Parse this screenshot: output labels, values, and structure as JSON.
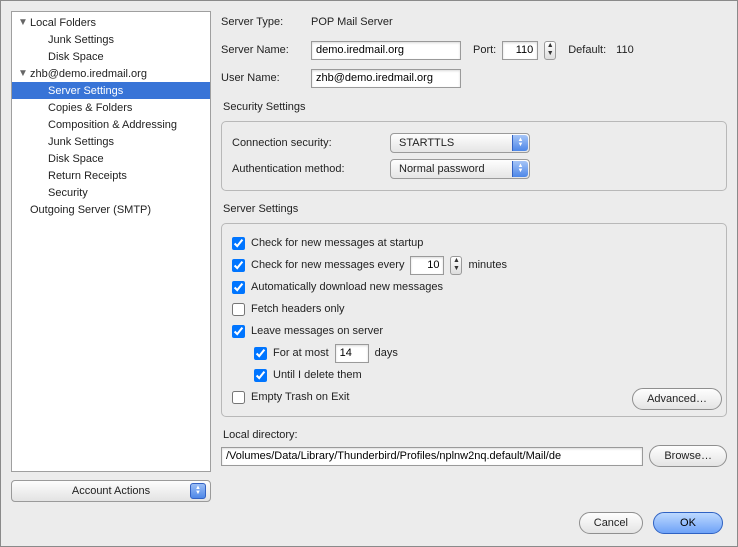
{
  "sidebar": {
    "items": [
      {
        "label": "Local Folders",
        "level": 0,
        "expandable": true
      },
      {
        "label": "Junk Settings",
        "level": 1
      },
      {
        "label": "Disk Space",
        "level": 1
      },
      {
        "label": "zhb@demo.iredmail.org",
        "level": 0,
        "expandable": true
      },
      {
        "label": "Server Settings",
        "level": 1,
        "selected": true
      },
      {
        "label": "Copies & Folders",
        "level": 1
      },
      {
        "label": "Composition & Addressing",
        "level": 1
      },
      {
        "label": "Junk Settings",
        "level": 1
      },
      {
        "label": "Disk Space",
        "level": 1
      },
      {
        "label": "Return Receipts",
        "level": 1
      },
      {
        "label": "Security",
        "level": 1
      },
      {
        "label": "Outgoing Server (SMTP)",
        "level": 0
      }
    ],
    "account_actions_label": "Account Actions"
  },
  "header": {
    "server_type_label": "Server Type:",
    "server_type_value": "POP Mail Server",
    "server_name_label": "Server Name:",
    "server_name_value": "demo.iredmail.org",
    "port_label": "Port:",
    "port_value": "110",
    "default_label": "Default:",
    "default_value": "110",
    "user_name_label": "User Name:",
    "user_name_value": "zhb@demo.iredmail.org"
  },
  "security": {
    "title": "Security Settings",
    "conn_label": "Connection security:",
    "conn_value": "STARTTLS",
    "auth_label": "Authentication method:",
    "auth_value": "Normal password"
  },
  "server_settings": {
    "title": "Server Settings",
    "check_startup": "Check for new messages at startup",
    "check_every_pre": "Check for new messages every",
    "check_every_value": "10",
    "check_every_post": "minutes",
    "auto_download": "Automatically download new messages",
    "fetch_headers": "Fetch headers only",
    "leave_on_server": "Leave messages on server",
    "for_at_most_pre": "For at most",
    "for_at_most_value": "14",
    "for_at_most_post": "days",
    "until_delete": "Until I delete them",
    "empty_trash": "Empty Trash on Exit",
    "advanced_label": "Advanced…"
  },
  "local_dir": {
    "label": "Local directory:",
    "value": "/Volumes/Data/Library/Thunderbird/Profiles/nplnw2nq.default/Mail/de",
    "browse_label": "Browse…"
  },
  "footer": {
    "cancel": "Cancel",
    "ok": "OK"
  }
}
